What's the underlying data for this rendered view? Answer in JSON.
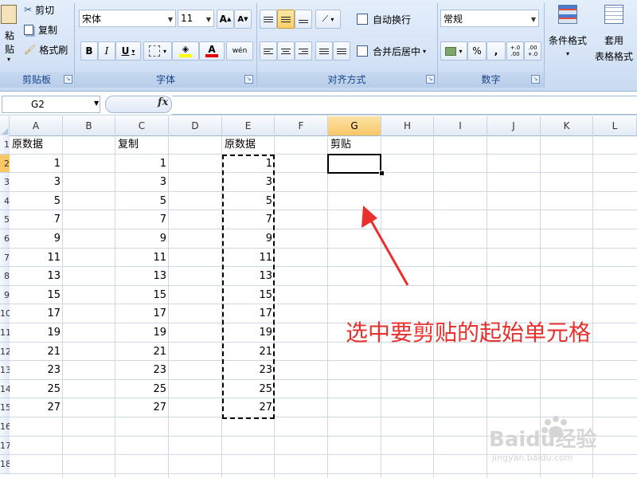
{
  "ribbon": {
    "clipboard": {
      "paste_label": "粘贴",
      "cut_label": "剪切",
      "copy_label": "复制",
      "format_painter_label": "格式刷",
      "group_label": "剪贴板"
    },
    "font": {
      "font_name": "宋体",
      "font_size": "11",
      "bold": "B",
      "italic": "I",
      "underline": "U",
      "wen": "wén",
      "group_label": "字体"
    },
    "alignment": {
      "wrap_text_label": "自动换行",
      "merge_center_label": "合并后居中",
      "group_label": "对齐方式"
    },
    "number": {
      "format_value": "常规",
      "percent": "%",
      "comma": ",",
      "inc_decimal": "+.0 .00",
      "dec_decimal": ".00 +.0",
      "group_label": "数字"
    },
    "styles": {
      "conditional_format_label": "条件格式",
      "table_format_label_1": "套用",
      "table_format_label_2": "表格格式"
    }
  },
  "formula_bar": {
    "name_box": "G2",
    "fx": "fx",
    "formula": ""
  },
  "sheet": {
    "columns": [
      "A",
      "B",
      "C",
      "D",
      "E",
      "F",
      "G",
      "H",
      "I",
      "J",
      "K",
      "L"
    ],
    "selected_column": "G",
    "row_numbers": [
      "1",
      "2",
      "3",
      "4",
      "5",
      "6",
      "7",
      "8",
      "9",
      "10",
      "11",
      "12",
      "13",
      "14",
      "15",
      "16",
      "17",
      "18"
    ],
    "selected_row": "2",
    "header_a": "原数据",
    "header_c": "复制",
    "header_e": "原数据",
    "header_g": "剪贴",
    "col_a": [
      "1",
      "3",
      "5",
      "7",
      "9",
      "11",
      "13",
      "15",
      "17",
      "19",
      "21",
      "23",
      "25",
      "27"
    ],
    "col_c": [
      "1",
      "3",
      "5",
      "7",
      "9",
      "11",
      "13",
      "15",
      "17",
      "19",
      "21",
      "23",
      "25",
      "27"
    ],
    "col_e": [
      "1",
      "3",
      "5",
      "7",
      "9",
      "11",
      "13",
      "15",
      "17",
      "19",
      "21",
      "23",
      "25",
      "27"
    ]
  },
  "annotation": "选中要剪贴的起始单元格",
  "colors": {
    "annotation": "#e8312c",
    "selected_header": "#f8c766",
    "ribbon_label": "#15428b"
  },
  "watermark": "Baidu经验 jingyan.baidu.com"
}
